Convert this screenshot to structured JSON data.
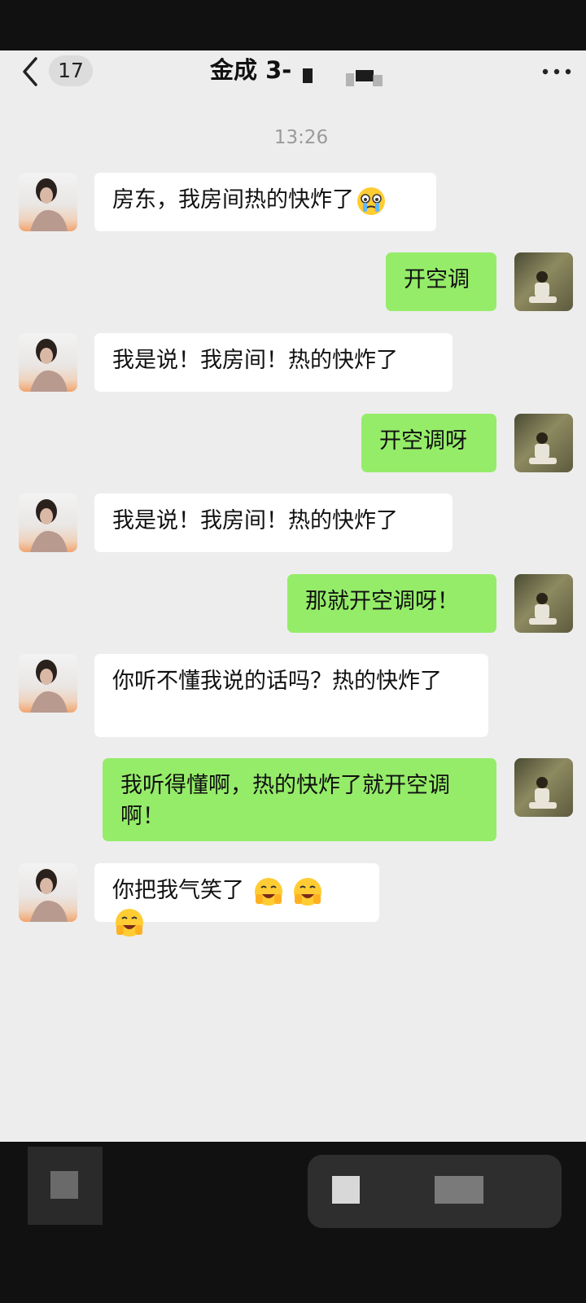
{
  "header": {
    "back_count": "17",
    "title": "金成 3-",
    "more_icon": "more-icon",
    "back_icon": "chevron-left-icon"
  },
  "timestamp": "13:26",
  "messages": [
    {
      "side": "left",
      "text": "房东，我房间热的快炸了",
      "emoji": "crying-face-emoji"
    },
    {
      "side": "right",
      "text": "开空调"
    },
    {
      "side": "left",
      "text": "我是说！我房间！热的快炸了"
    },
    {
      "side": "right",
      "text": "开空调呀"
    },
    {
      "side": "left",
      "text": "我是说！我房间！热的快炸了"
    },
    {
      "side": "right",
      "text": "那就开空调呀！"
    },
    {
      "side": "left",
      "text": "你听不懂我说的话吗？热的快炸了"
    },
    {
      "side": "right",
      "text": "我听得懂啊，热的快炸了就开空调啊！"
    },
    {
      "side": "left",
      "text": "你把我气笑了",
      "emoji": "laughing-crying-emoji x3"
    }
  ],
  "colors": {
    "chat_bg": "#ededed",
    "left_bubble": "#ffffff",
    "right_bubble": "#95ec69",
    "time_text": "#9a9a9a"
  }
}
